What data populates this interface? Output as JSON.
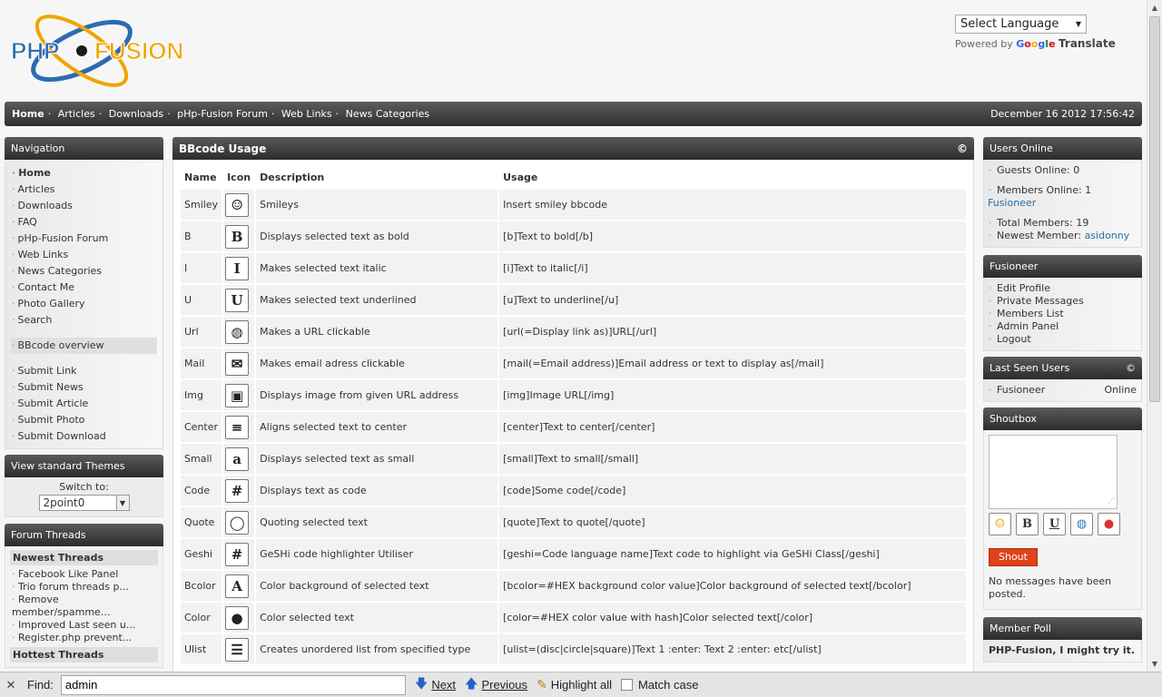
{
  "header": {
    "logo_text": "PHP-FUSION",
    "language_select": "Select Language",
    "powered_by": "Powered by",
    "google": "Google",
    "translate": "Translate"
  },
  "navbar": {
    "links": [
      "Home",
      "Articles",
      "Downloads",
      "pHp-Fusion Forum",
      "Web Links",
      "News Categories"
    ],
    "datetime": "December 16 2012 17:56:42"
  },
  "navigation": {
    "title": "Navigation",
    "items": [
      "Home",
      "Articles",
      "Downloads",
      "FAQ",
      "pHp-Fusion Forum",
      "Web Links",
      "News Categories",
      "Contact Me",
      "Photo Gallery",
      "Search"
    ],
    "bbcode_item": "BBcode overview",
    "submit_items": [
      "Submit Link",
      "Submit News",
      "Submit Article",
      "Submit Photo",
      "Submit Download"
    ]
  },
  "themes": {
    "title": "View standard Themes",
    "switch_label": "Switch to:",
    "selected": "2point0"
  },
  "forum_threads": {
    "title": "Forum Threads",
    "newest_label": "Newest Threads",
    "newest": [
      "Facebook Like Panel",
      "Trio forum threads p...",
      "Remove",
      "member/spamme...",
      "Improved Last seen u...",
      "Register.php prevent..."
    ],
    "hottest_label": "Hottest Threads"
  },
  "bbcode": {
    "title": "BBcode Usage",
    "copyright": "©",
    "columns": [
      "Name",
      "Icon",
      "Description",
      "Usage"
    ],
    "rows": [
      {
        "name": "Smiley",
        "icon": "☺",
        "icon_name": "smiley-icon",
        "desc": "Smileys",
        "usage": "Insert smiley bbcode"
      },
      {
        "name": "B",
        "icon": "B",
        "icon_name": "bold-icon",
        "desc": "Displays selected text as bold",
        "usage": "[b]Text to bold[/b]"
      },
      {
        "name": "I",
        "icon": "I",
        "icon_name": "italic-icon",
        "desc": "Makes selected text italic",
        "usage": "[i]Text to italic[/i]"
      },
      {
        "name": "U",
        "icon": "U",
        "icon_name": "underline-icon",
        "desc": "Makes selected text underlined",
        "usage": "[u]Text to underline[/u]"
      },
      {
        "name": "Url",
        "icon": "◍",
        "icon_name": "url-icon",
        "desc": "Makes a URL clickable",
        "usage": "[url(=Display link as)]URL[/url]"
      },
      {
        "name": "Mail",
        "icon": "✉",
        "icon_name": "mail-icon",
        "desc": "Makes email adress clickable",
        "usage": "[mail(=Email address)]Email address or text to display as[/mail]"
      },
      {
        "name": "Img",
        "icon": "▣",
        "icon_name": "image-icon",
        "desc": "Displays image from given URL address",
        "usage": "[img]Image URL[/img]"
      },
      {
        "name": "Center",
        "icon": "≡",
        "icon_name": "center-icon",
        "desc": "Aligns selected text to center",
        "usage": "[center]Text to center[/center]"
      },
      {
        "name": "Small",
        "icon": "a",
        "icon_name": "small-text-icon",
        "desc": "Displays selected text as small",
        "usage": "[small]Text to small[/small]"
      },
      {
        "name": "Code",
        "icon": "#",
        "icon_name": "code-icon",
        "desc": "Displays text as code",
        "usage": "[code]Some code[/code]"
      },
      {
        "name": "Quote",
        "icon": "◯",
        "icon_name": "quote-icon",
        "desc": "Quoting selected text",
        "usage": "[quote]Text to quote[/quote]"
      },
      {
        "name": "Geshi",
        "icon": "#",
        "icon_name": "geshi-icon",
        "desc": "GeSHi code highlighter Utiliser",
        "usage": "[geshi=Code language name]Text code to highlight via GeSHi Class[/geshi]"
      },
      {
        "name": "Bcolor",
        "icon": "A",
        "icon_name": "background-color-icon",
        "desc": "Color background of selected text",
        "usage": "[bcolor=#HEX background color value]Color background of selected text[/bcolor]"
      },
      {
        "name": "Color",
        "icon": "●",
        "icon_name": "color-icon",
        "desc": "Color selected text",
        "usage": "[color=#HEX color value with hash]Color selected text[/color]"
      },
      {
        "name": "Ulist",
        "icon": "☰",
        "icon_name": "unordered-list-icon",
        "desc": "Creates unordered list from specified type",
        "usage": "[ulist=(disc|circle|square)]Text 1 :enter: Text 2 :enter: etc[/ulist]"
      }
    ]
  },
  "users_online": {
    "title": "Users Online",
    "guests": "Guests Online: 0",
    "members": "Members Online: 1",
    "member_name": "Fusioneer",
    "total": "Total Members: 19",
    "newest_label": "Newest Member:",
    "newest_name": "asidonny"
  },
  "fusioneer": {
    "title": "Fusioneer",
    "items": [
      "Edit Profile",
      "Private Messages",
      "Members List",
      "Admin Panel",
      "Logout"
    ]
  },
  "last_seen": {
    "title": "Last Seen Users",
    "copyright": "©",
    "user": "Fusioneer",
    "status": "Online"
  },
  "shoutbox": {
    "title": "Shoutbox",
    "button": "Shout",
    "empty": "No messages have been posted."
  },
  "poll": {
    "title": "Member Poll",
    "question": "PHP-Fusion, I might try it."
  },
  "findbar": {
    "label": "Find:",
    "value": "admin",
    "next": "Next",
    "previous": "Previous",
    "highlight": "Highlight all",
    "match_case": "Match case"
  }
}
